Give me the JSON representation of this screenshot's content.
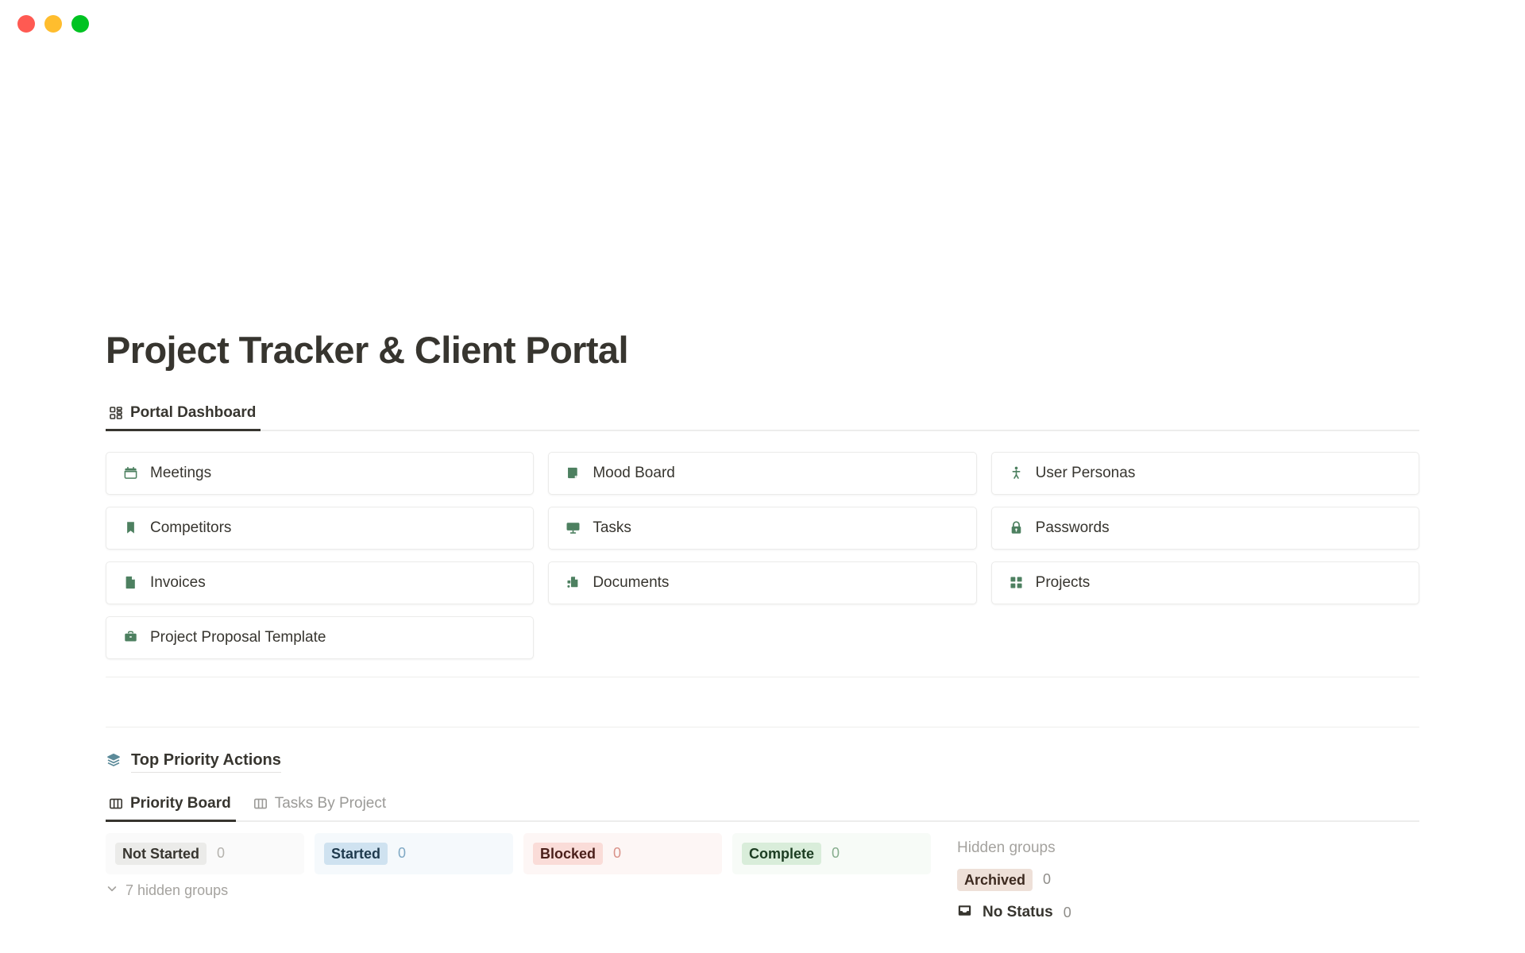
{
  "window": {
    "buttons": [
      {
        "name": "close",
        "color": "#ff5a52"
      },
      {
        "name": "minimize",
        "color": "#ffbd2e"
      },
      {
        "name": "maximize",
        "color": "#00c322"
      }
    ]
  },
  "header": {
    "title": "Project Tracker & Client Portal"
  },
  "main_tabs": [
    {
      "label": "Portal Dashboard",
      "icon": "grid-squares-icon",
      "active": true
    }
  ],
  "cards": [
    {
      "label": "Meetings",
      "icon": "calendar-icon",
      "color": "#4d8060"
    },
    {
      "label": "Mood Board",
      "icon": "book-icon",
      "color": "#4d8060"
    },
    {
      "label": "User Personas",
      "icon": "person-icon",
      "color": "#4d8060"
    },
    {
      "label": "Competitors",
      "icon": "bookmark-icon",
      "color": "#4d8060"
    },
    {
      "label": "Tasks",
      "icon": "monitor-icon",
      "color": "#4d8060"
    },
    {
      "label": "Passwords",
      "icon": "lock-icon",
      "color": "#4d8060"
    },
    {
      "label": "Invoices",
      "icon": "file-icon",
      "color": "#4d8060"
    },
    {
      "label": "Documents",
      "icon": "documents-icon",
      "color": "#4d8060"
    },
    {
      "label": "Projects",
      "icon": "grid-blocks-icon",
      "color": "#4d8060"
    },
    {
      "label": "Project Proposal Template",
      "icon": "briefcase-icon",
      "color": "#4d8060"
    }
  ],
  "section": {
    "title": "Top Priority Actions",
    "icon": "layers-icon",
    "icon_color": "#5b8a99"
  },
  "sub_tabs": [
    {
      "label": "Priority Board",
      "icon": "board-columns-icon",
      "active": true
    },
    {
      "label": "Tasks By Project",
      "icon": "board-columns-icon",
      "active": false
    }
  ],
  "board": {
    "columns": [
      {
        "label": "Not Started",
        "count": "0",
        "chip_bg": "#ebebe9",
        "chip_fg": "#37352f",
        "panel_bg": "#fafafa",
        "count_fg": "#b5b3ae"
      },
      {
        "label": "Started",
        "count": "0",
        "chip_bg": "#cfe2f0",
        "chip_fg": "#1f3a4d",
        "panel_bg": "#f5f9fc",
        "count_fg": "#7fa8c4"
      },
      {
        "label": "Blocked",
        "count": "0",
        "chip_bg": "#fadcd8",
        "chip_fg": "#4a1f1a",
        "panel_bg": "#fdf6f5",
        "count_fg": "#d99289"
      },
      {
        "label": "Complete",
        "count": "0",
        "chip_bg": "#d9edda",
        "chip_fg": "#1c3d22",
        "panel_bg": "#f7fbf7",
        "count_fg": "#86ad8d"
      }
    ],
    "collapse": {
      "label": "7 hidden groups",
      "icon": "chevron-down-icon"
    },
    "hidden": {
      "title": "Hidden groups",
      "groups": [
        {
          "label": "Archived",
          "count": "0",
          "chip_bg": "#eee0d8",
          "chip_fg": "#3d2a20",
          "count_fg": "#8f8d89",
          "icon": null
        },
        {
          "label": "No Status",
          "count": "0",
          "chip_bg": "transparent",
          "chip_fg": "#37352f",
          "count_fg": "#8f8d89",
          "icon": "inbox-icon"
        }
      ]
    }
  }
}
